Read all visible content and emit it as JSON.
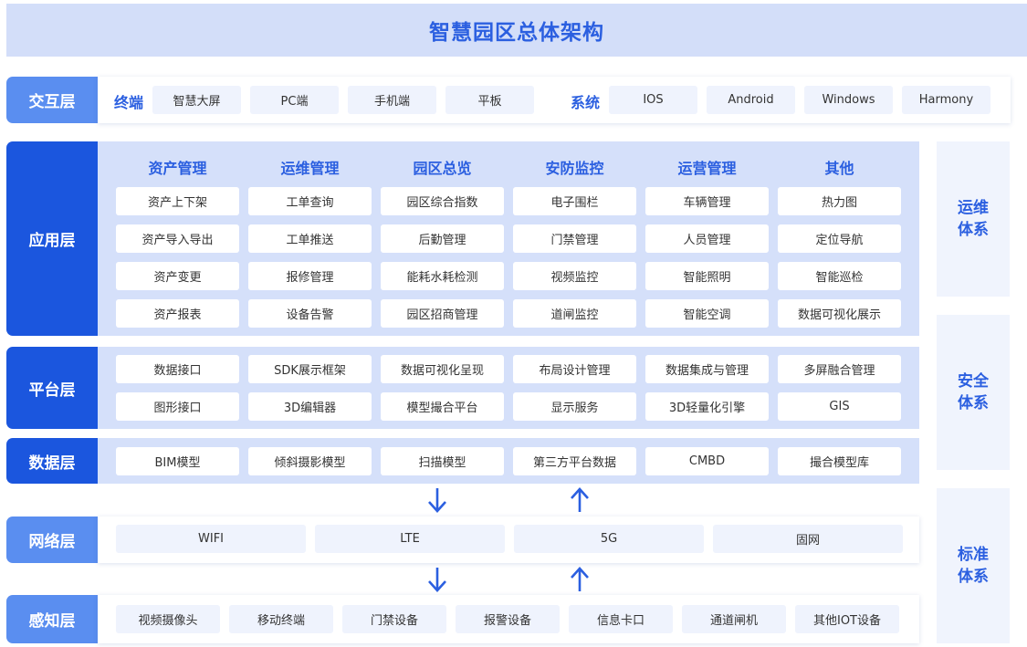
{
  "title": "智慧园区总体架构",
  "interaction": {
    "label": "交互层",
    "terminal_title": "终端",
    "terminals": [
      "智慧大屏",
      "PC端",
      "手机端",
      "平板"
    ],
    "system_title": "系统",
    "systems": [
      "IOS",
      "Android",
      "Windows",
      "Harmony"
    ]
  },
  "application": {
    "label": "应用层",
    "columns": [
      {
        "header": "资产管理",
        "items": [
          "资产上下架",
          "资产导入导出",
          "资产变更",
          "资产报表"
        ]
      },
      {
        "header": "运维管理",
        "items": [
          "工单查询",
          "工单推送",
          "报修管理",
          "设备告警"
        ]
      },
      {
        "header": "园区总览",
        "items": [
          "园区综合指数",
          "后勤管理",
          "能耗水耗检测",
          "园区招商管理"
        ]
      },
      {
        "header": "安防监控",
        "items": [
          "电子围栏",
          "门禁管理",
          "视频监控",
          "道闸监控"
        ]
      },
      {
        "header": "运营管理",
        "items": [
          "车辆管理",
          "人员管理",
          "智能照明",
          "智能空调"
        ]
      },
      {
        "header": "其他",
        "items": [
          "热力图",
          "定位导航",
          "智能巡检",
          "数据可视化展示"
        ]
      }
    ]
  },
  "platform": {
    "label": "平台层",
    "rows": [
      [
        "数据接口",
        "SDK展示框架",
        "数据可视化呈现",
        "布局设计管理",
        "数据集成与管理",
        "多屏融合管理"
      ],
      [
        "图形接口",
        "3D编辑器",
        "模型撮合平台",
        "显示服务",
        "3D轻量化引擎",
        "GIS"
      ]
    ]
  },
  "data_layer": {
    "label": "数据层",
    "items": [
      "BIM模型",
      "倾斜摄影模型",
      "扫描模型",
      "第三方平台数据",
      "CMBD",
      "撮合模型库"
    ]
  },
  "network": {
    "label": "网络层",
    "items": [
      "WIFI",
      "LTE",
      "5G",
      "固网"
    ]
  },
  "perception": {
    "label": "感知层",
    "items": [
      "视频摄像头",
      "移动终端",
      "门禁设备",
      "报警设备",
      "信息卡口",
      "通道闸机",
      "其他IOT设备"
    ]
  },
  "side_systems": [
    "运维体系",
    "安全体系",
    "标准体系"
  ],
  "colors": {
    "accent": "#2b5fe0",
    "layer_dark": "#1b56de",
    "layer_light": "#5a8ef0",
    "panel": "#d5e0fa"
  }
}
